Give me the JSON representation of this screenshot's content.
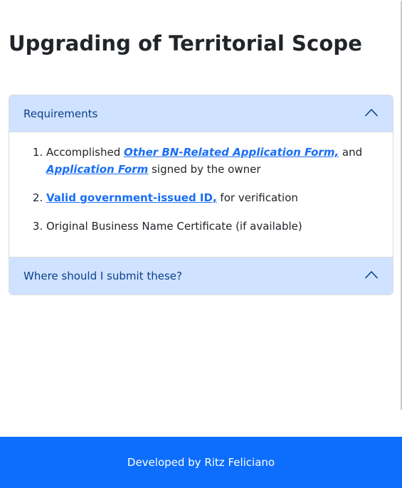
{
  "page": {
    "title": "Upgrading of Territorial Scope"
  },
  "accordion": {
    "requirements": {
      "label": "Requirements",
      "icon": "chevron-up-icon",
      "items": [
        {
          "prefix": "Accomplished ",
          "link1": "Other BN-Related Application Form,",
          "middle": " and",
          "link2": "Application Form",
          "suffix": " signed by the owner"
        },
        {
          "link": "Valid government-issued ID,",
          "suffix": " for verification"
        },
        {
          "text": "Original Business Name Certificate (if available)"
        }
      ]
    },
    "submit": {
      "label": "Where should I submit these?",
      "icon": "chevron-up-icon"
    }
  },
  "footer": {
    "text": "Developed by Ritz Feliciano"
  },
  "colors": {
    "accent": "#0d6efd",
    "header_bg": "#cfe2ff",
    "header_text": "#0c3f8a",
    "link": "#1a6ef5"
  }
}
